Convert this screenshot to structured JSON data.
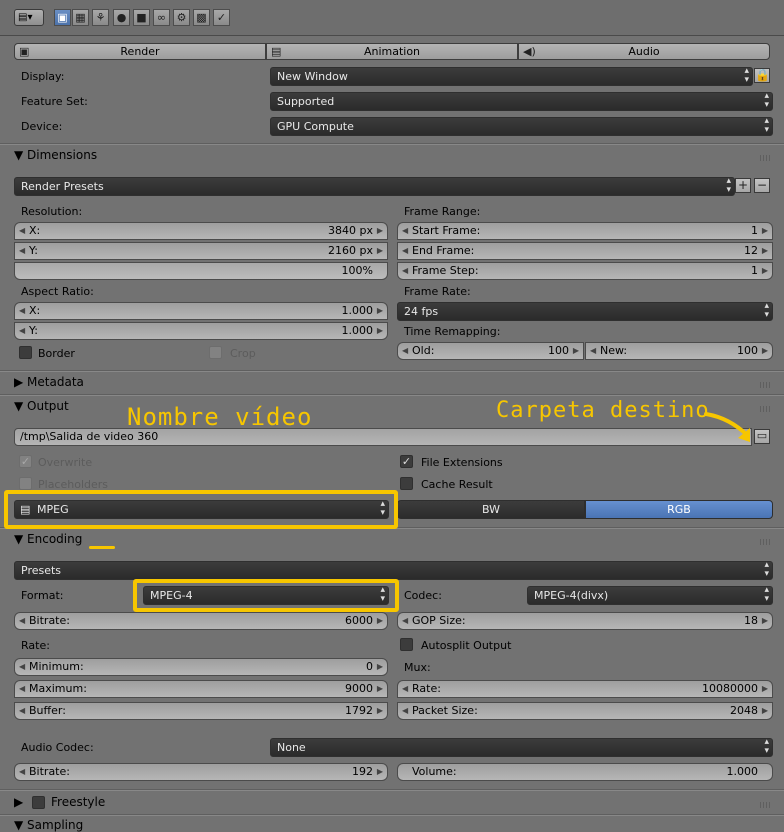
{
  "colors": {
    "highlight": "#f7c600",
    "selected": "#5680c2",
    "bg": "#727272"
  },
  "tabs": {
    "render": "Render",
    "animation": "Animation",
    "audio": "Audio"
  },
  "settings": {
    "display_label": "Display:",
    "display_value": "New Window",
    "feature_label": "Feature Set:",
    "feature_value": "Supported",
    "device_label": "Device:",
    "device_value": "GPU Compute"
  },
  "dimensions": {
    "title": "Dimensions",
    "presets": "Render Presets",
    "resolution_label": "Resolution:",
    "x_label": "X:",
    "x_value": "3840 px",
    "y_label": "Y:",
    "y_value": "2160 px",
    "percent": "100%",
    "aspect_label": "Aspect Ratio:",
    "ax_label": "X:",
    "ax_value": "1.000",
    "ay_label": "Y:",
    "ay_value": "1.000",
    "border_label": "Border",
    "crop_label": "Crop",
    "frame_range_label": "Frame Range:",
    "start_label": "Start Frame:",
    "start_value": "1",
    "end_label": "End Frame:",
    "end_value": "12",
    "step_label": "Frame Step:",
    "step_value": "1",
    "frame_rate_label": "Frame Rate:",
    "frame_rate_value": "24 fps",
    "time_remap_label": "Time Remapping:",
    "old_label": "Old:",
    "old_value": "100",
    "new_label": "New:",
    "new_value": "100"
  },
  "metadata": {
    "title": "Metadata"
  },
  "output": {
    "title": "Output",
    "path": "/tmp\\Salida de video 360",
    "overwrite_label": "Overwrite",
    "placeholders_label": "Placeholders",
    "file_ext_label": "File Extensions",
    "cache_label": "Cache Result",
    "format_value": "MPEG",
    "bw_label": "BW",
    "rgb_label": "RGB"
  },
  "annotations": {
    "video_name": "Nombre vídeo",
    "dest_folder": "Carpeta destino"
  },
  "encoding": {
    "title": "Encoding",
    "presets": "Presets",
    "format_label": "Format:",
    "format_value": "MPEG-4",
    "codec_label": "Codec:",
    "codec_value": "MPEG-4(divx)",
    "bitrate_label": "Bitrate:",
    "bitrate_value": "6000",
    "gop_label": "GOP Size:",
    "gop_value": "18",
    "rate_label": "Rate:",
    "autosplit_label": "Autosplit Output",
    "minimum_label": "Minimum:",
    "minimum_value": "0",
    "mux_label": "Mux:",
    "maximum_label": "Maximum:",
    "maximum_value": "9000",
    "mux_rate_label": "Rate:",
    "mux_rate_value": "10080000",
    "buffer_label": "Buffer:",
    "buffer_value": "1792",
    "packet_label": "Packet Size:",
    "packet_value": "2048",
    "audio_codec_label": "Audio Codec:",
    "audio_codec_value": "None",
    "audio_bitrate_label": "Bitrate:",
    "audio_bitrate_value": "192",
    "volume_label": "Volume:",
    "volume_value": "1.000"
  },
  "freestyle": {
    "title": "Freestyle"
  },
  "sampling": {
    "title": "Sampling"
  }
}
